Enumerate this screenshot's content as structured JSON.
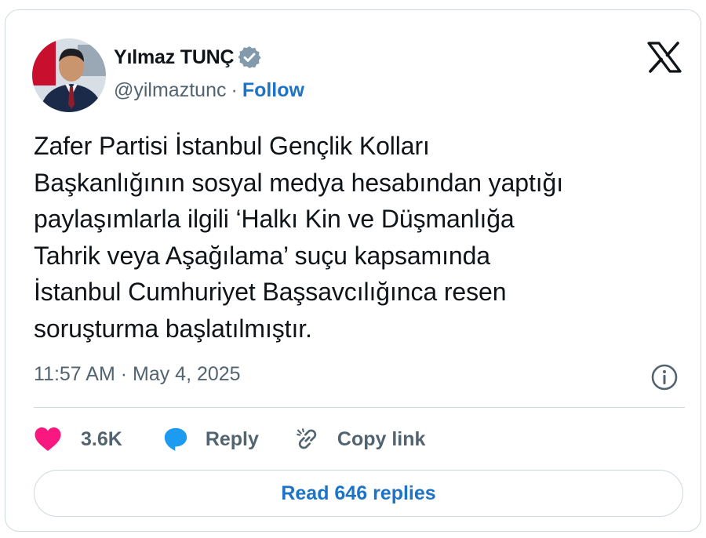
{
  "author": {
    "name": "Yılmaz TUNÇ",
    "handle": "@yilmaztunc",
    "separator": "·",
    "follow_label": "Follow"
  },
  "tweet": {
    "text": "Zafer Partisi İstanbul Gençlik Kolları\nBaşkanlığının sosyal medya hesabından yaptığı\npaylaşımlarla ilgili ‘Halkı Kin ve Düşmanlığa\nTahrik veya Aşağılama’ suçu kapsamında\nİstanbul Cumhuriyet Başsavcılığınca resen\nsoruşturma başlatılmıştır.",
    "timestamp": "11:57 AM · May 4, 2025"
  },
  "actions": {
    "like_count": "3.6K",
    "reply_label": "Reply",
    "copy_link_label": "Copy link"
  },
  "read_replies_label": "Read 646 replies",
  "colors": {
    "like": "#f91880",
    "reply": "#1d9bf0",
    "link": "#1d74c7",
    "muted": "#536471",
    "border": "#cfd9de"
  },
  "icons": [
    "verified-badge-icon",
    "x-logo-icon",
    "info-icon",
    "heart-icon",
    "reply-bubble-icon",
    "link-icon"
  ]
}
